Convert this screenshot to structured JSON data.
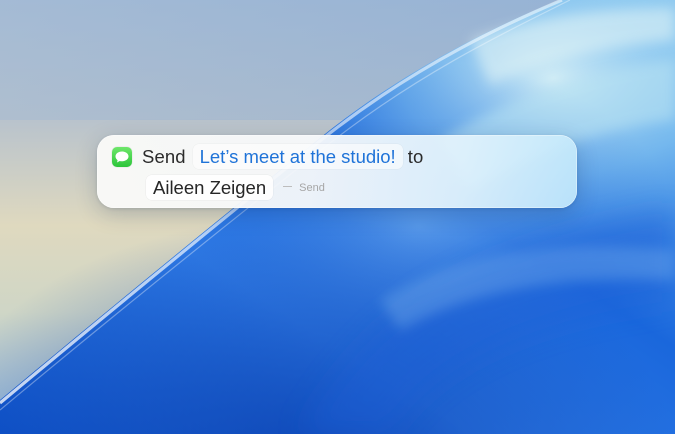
{
  "shortcut": {
    "app_icon": "messages-icon",
    "verb": "Send",
    "message": "Let’s meet at the studio!",
    "connector": "to",
    "recipient": "Aileen Zeigen",
    "action_hint": "Send"
  },
  "colors": {
    "message_token_text": "#1f73d8",
    "app_icon_green": "#34c759",
    "hint_text": "#a6a6a6"
  }
}
